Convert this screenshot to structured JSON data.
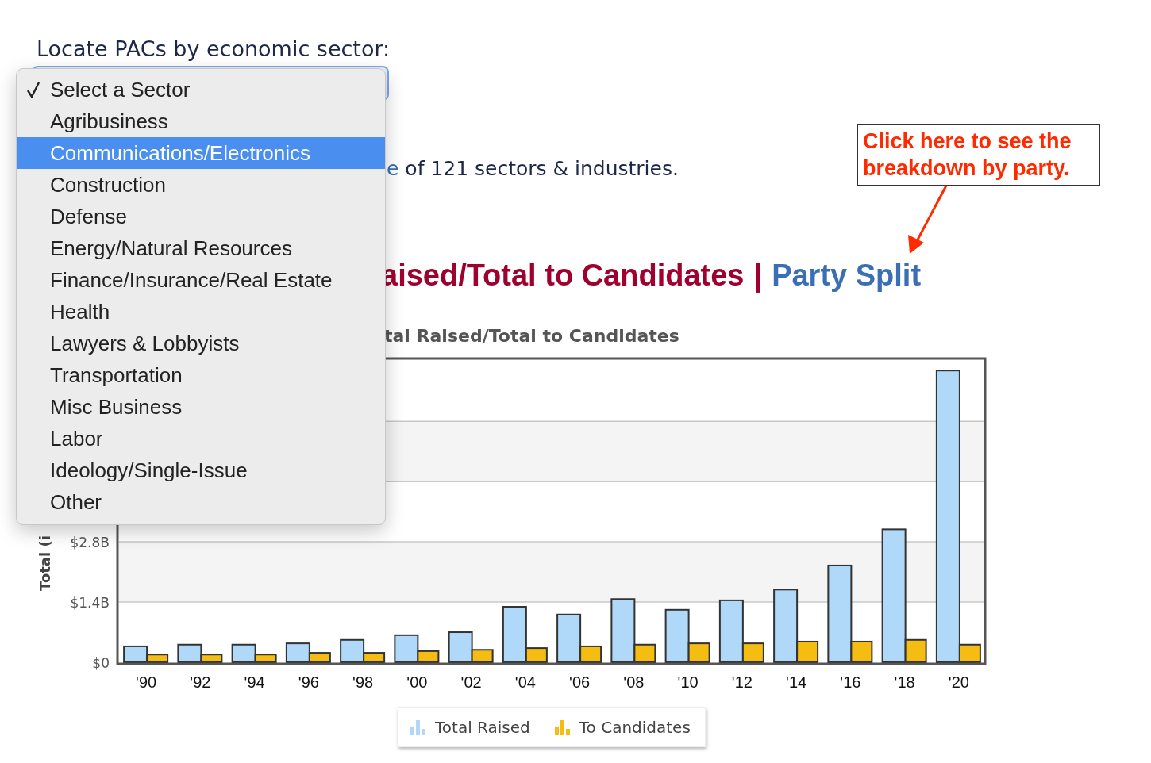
{
  "sector_prompt": "Locate PACs by economic sector:",
  "sector_select": {
    "options": [
      {
        "label": "Select a Sector",
        "checked": true,
        "highlighted": false
      },
      {
        "label": "Agribusiness",
        "checked": false,
        "highlighted": false
      },
      {
        "label": "Communications/Electronics",
        "checked": false,
        "highlighted": true
      },
      {
        "label": "Construction",
        "checked": false,
        "highlighted": false
      },
      {
        "label": "Defense",
        "checked": false,
        "highlighted": false
      },
      {
        "label": "Energy/Natural Resources",
        "checked": false,
        "highlighted": false
      },
      {
        "label": "Finance/Insurance/Real Estate",
        "checked": false,
        "highlighted": false
      },
      {
        "label": "Health",
        "checked": false,
        "highlighted": false
      },
      {
        "label": "Lawyers & Lobbyists",
        "checked": false,
        "highlighted": false
      },
      {
        "label": "Transportation",
        "checked": false,
        "highlighted": false
      },
      {
        "label": "Misc Business",
        "checked": false,
        "highlighted": false
      },
      {
        "label": "Labor",
        "checked": false,
        "highlighted": false
      },
      {
        "label": "Ideology/Single-Issue",
        "checked": false,
        "highlighted": false
      },
      {
        "label": "Other",
        "checked": false,
        "highlighted": false
      }
    ]
  },
  "browse_note": {
    "link": "e",
    "text": " of 121 sectors & industries."
  },
  "annotation": "Click here to see the breakdown by party.",
  "chart_heading": {
    "title": "aised/Total to Candidates",
    "separator": "|",
    "link": "Party Split"
  },
  "chart": {
    "chart_data": {
      "type": "bar",
      "title": "tal Raised/Total to Candidates",
      "ylabel": "Total (i",
      "categories": [
        "'90",
        "'92",
        "'94",
        "'96",
        "'98",
        "'00",
        "'02",
        "'04",
        "'06",
        "'08",
        "'10",
        "'12",
        "'14",
        "'16",
        "'18",
        "'20"
      ],
      "series": [
        {
          "name": "Total Raised",
          "color": "#b0d8f8",
          "values": [
            0.37,
            0.41,
            0.41,
            0.44,
            0.52,
            0.63,
            0.7,
            1.29,
            1.11,
            1.47,
            1.22,
            1.44,
            1.69,
            2.25,
            3.09,
            6.78
          ]
        },
        {
          "name": "To Candidates",
          "color": "#f5bd12",
          "values": [
            0.18,
            0.18,
            0.18,
            0.22,
            0.22,
            0.26,
            0.29,
            0.33,
            0.37,
            0.41,
            0.44,
            0.44,
            0.48,
            0.48,
            0.52,
            0.41
          ]
        }
      ],
      "ylim": [
        0,
        7.06
      ],
      "yticks": [
        {
          "value": 0,
          "label": "$0"
        },
        {
          "value": 1.4,
          "label": "$1.4B"
        },
        {
          "value": 2.8,
          "label": "$2.8B"
        }
      ]
    }
  }
}
